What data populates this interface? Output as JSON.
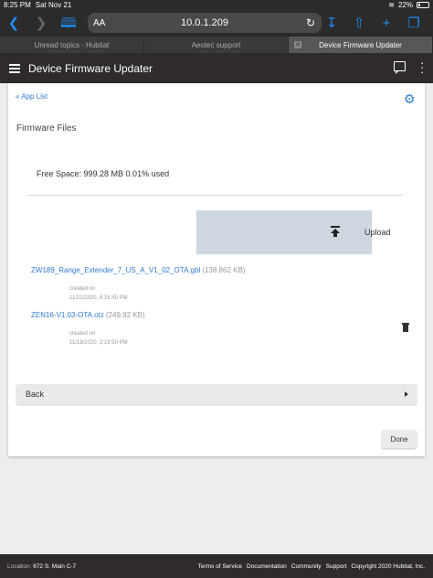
{
  "status_bar": {
    "time": "8:25 PM",
    "date": "Sat Nov 21",
    "battery": "22%",
    "battery_level": 0.22
  },
  "browser": {
    "text_size_label": "AA",
    "url": "10.0.1.209",
    "tabs": [
      {
        "label": "Unread topics - Hubitat",
        "active": false
      },
      {
        "label": "Aeotec support",
        "active": false
      },
      {
        "label": "Device Firmware Updater",
        "active": true
      }
    ]
  },
  "header": {
    "title": "Device Firmware Updater"
  },
  "main": {
    "app_list_link": "« App List",
    "section_title": "Firmware Files",
    "free_space": "Free Space: 999.28 MB 0.01% used",
    "upload_label": "Upload",
    "files": [
      {
        "name": "ZW189_Range_Extender_7_US_A_V1_02_OTA.gbl",
        "size": "(138.862 KB)",
        "created_label": "created on",
        "created_date": "11/21/2020, 8:16:45 PM"
      },
      {
        "name": "ZEN16-V1.03-OTA.otz",
        "size": "(249.92 KB)",
        "created_label": "created on",
        "created_date": "11/18/2020, 2:19:50 PM"
      }
    ],
    "back_label": "Back",
    "done_label": "Done"
  },
  "footer": {
    "location_label": "Location:",
    "location_value": "672 S. Main C-7",
    "links": [
      "Terms of Service",
      "Documentation",
      "Community",
      "Support",
      "Copyright 2020 Hubitat, Inc."
    ]
  },
  "colors": {
    "app_bar": "#2f2b2b",
    "link": "#2f7bd1",
    "browser_accent": "#1e8cf2",
    "upload_box": "#ced6e0"
  }
}
